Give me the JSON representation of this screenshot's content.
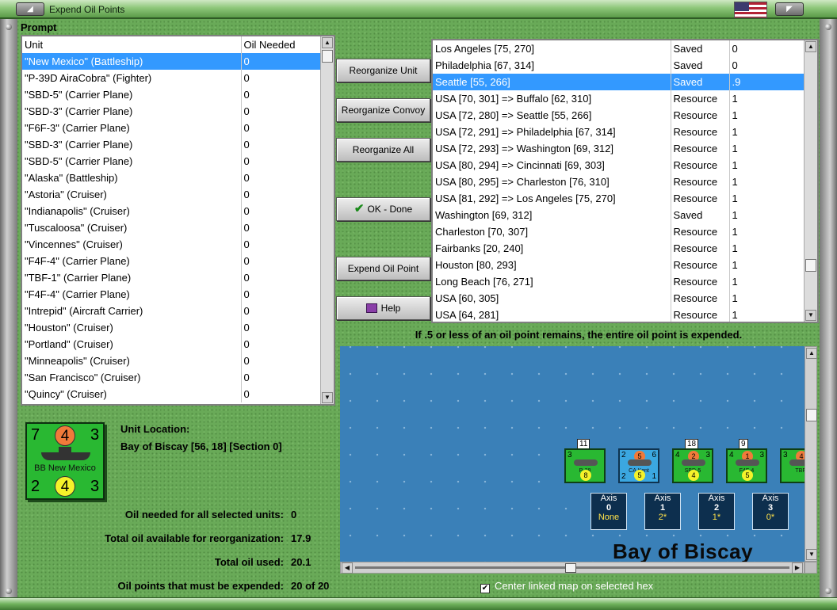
{
  "window": {
    "title": "Expend Oil Points"
  },
  "prompt_label": "Prompt",
  "unit_list": {
    "headers": [
      "Unit",
      "Oil Needed"
    ],
    "rows": [
      {
        "unit": "\"New Mexico\" (Battleship)",
        "oil": "0",
        "selected": true
      },
      {
        "unit": "\"P-39D AiraCobra\" (Fighter)",
        "oil": "0"
      },
      {
        "unit": "\"SBD-5\" (Carrier Plane)",
        "oil": "0"
      },
      {
        "unit": "\"SBD-3\" (Carrier Plane)",
        "oil": "0"
      },
      {
        "unit": "\"F6F-3\" (Carrier Plane)",
        "oil": "0"
      },
      {
        "unit": "\"SBD-3\" (Carrier Plane)",
        "oil": "0"
      },
      {
        "unit": "\"SBD-5\" (Carrier Plane)",
        "oil": "0"
      },
      {
        "unit": "\"Alaska\" (Battleship)",
        "oil": "0"
      },
      {
        "unit": "\"Astoria\" (Cruiser)",
        "oil": "0"
      },
      {
        "unit": "\"Indianapolis\" (Cruiser)",
        "oil": "0"
      },
      {
        "unit": "\"Tuscaloosa\" (Cruiser)",
        "oil": "0"
      },
      {
        "unit": "\"Vincennes\" (Cruiser)",
        "oil": "0"
      },
      {
        "unit": "\"F4F-4\" (Carrier Plane)",
        "oil": "0"
      },
      {
        "unit": "\"TBF-1\" (Carrier Plane)",
        "oil": "0"
      },
      {
        "unit": "\"F4F-4\" (Carrier Plane)",
        "oil": "0"
      },
      {
        "unit": "\"Intrepid\" (Aircraft Carrier)",
        "oil": "0"
      },
      {
        "unit": "\"Houston\" (Cruiser)",
        "oil": "0"
      },
      {
        "unit": "\"Portland\" (Cruiser)",
        "oil": "0"
      },
      {
        "unit": "\"Minneapolis\" (Cruiser)",
        "oil": "0"
      },
      {
        "unit": "\"San Francisco\" (Cruiser)",
        "oil": "0"
      },
      {
        "unit": "\"Quincy\" (Cruiser)",
        "oil": "0"
      }
    ]
  },
  "buttons": {
    "reorganize_unit": "Reorganize Unit",
    "reorganize_convoy": "Reorganize Convoy",
    "reorganize_all": "Reorganize All",
    "ok_done": "OK - Done",
    "expend_oil_point": "Expend Oil Point",
    "help": "Help"
  },
  "oil_list": {
    "rows": [
      {
        "location": "Los Angeles [75, 270]",
        "type": "Saved",
        "amount": "0"
      },
      {
        "location": "Philadelphia [67, 314]",
        "type": "Saved",
        "amount": "0"
      },
      {
        "location": "Seattle [55, 266]",
        "type": "Saved",
        "amount": ".9",
        "selected": true
      },
      {
        "location": "USA [70, 301] => Buffalo [62, 310]",
        "type": "Resource",
        "amount": "1"
      },
      {
        "location": "USA [72, 280] => Seattle [55, 266]",
        "type": "Resource",
        "amount": "1"
      },
      {
        "location": "USA [72, 291] => Philadelphia [67, 314]",
        "type": "Resource",
        "amount": "1"
      },
      {
        "location": "USA [72, 293] => Washington [69, 312]",
        "type": "Resource",
        "amount": "1"
      },
      {
        "location": "USA [80, 294] => Cincinnati [69, 303]",
        "type": "Resource",
        "amount": "1"
      },
      {
        "location": "USA [80, 295] => Charleston [76, 310]",
        "type": "Resource",
        "amount": "1"
      },
      {
        "location": "USA [81, 292] => Los Angeles [75, 270]",
        "type": "Resource",
        "amount": "1"
      },
      {
        "location": "Washington [69, 312]",
        "type": "Saved",
        "amount": "1"
      },
      {
        "location": "Charleston [70, 307]",
        "type": "Resource",
        "amount": "1"
      },
      {
        "location": "Fairbanks [20, 240]",
        "type": "Resource",
        "amount": "1"
      },
      {
        "location": "Houston [80, 293]",
        "type": "Resource",
        "amount": "1"
      },
      {
        "location": "Long Beach [76, 271]",
        "type": "Resource",
        "amount": "1"
      },
      {
        "location": "USA [60, 305]",
        "type": "Resource",
        "amount": "1"
      },
      {
        "location": "USA [64, 281]",
        "type": "Resource",
        "amount": "1"
      }
    ]
  },
  "note": "If .5 or less of an oil point remains, the entire oil point is expended.",
  "map": {
    "name": "Bay of Biscay",
    "stacks": [
      {
        "count": "11",
        "top_left": "3",
        "top_right": "",
        "circle": "",
        "bottom_left": "",
        "bottom_circle": "8",
        "bottom_right": "",
        "label": "P-38",
        "color": "green"
      },
      {
        "count": "",
        "top_left": "2",
        "top_right": "6",
        "circle": "5",
        "bottom_left": "2",
        "bottom_circle": "5",
        "bottom_right": "1",
        "label": "CA Kent",
        "color": "blue"
      },
      {
        "count": "18",
        "top_left": "4",
        "top_right": "3",
        "circle": "2",
        "bottom_left": "",
        "bottom_circle": "4",
        "bottom_right": "",
        "label": "SBD-5",
        "color": "green"
      },
      {
        "count": "9",
        "top_left": "4",
        "top_right": "3",
        "circle": "1",
        "bottom_left": "",
        "bottom_circle": "5",
        "bottom_right": "",
        "label": "F4F-4",
        "color": "green"
      },
      {
        "count": "",
        "top_left": "3",
        "top_right": "",
        "circle": "4",
        "bottom_left": "",
        "bottom_circle": "",
        "bottom_right": "",
        "label": "TBF",
        "color": "green"
      }
    ],
    "axis_boxes": [
      {
        "title": "Axis",
        "num": "0",
        "sub": "None"
      },
      {
        "title": "Axis",
        "num": "1",
        "sub": "2*"
      },
      {
        "title": "Axis",
        "num": "2",
        "sub": "1*"
      },
      {
        "title": "Axis",
        "num": "3",
        "sub": "0*"
      }
    ]
  },
  "unit_counter": {
    "top_left": "7",
    "top_mid": "4",
    "top_right": "3",
    "bottom_left": "2",
    "bottom_mid": "4",
    "bottom_right": "3",
    "name": "BB New Mexico"
  },
  "location": {
    "label": "Unit Location:",
    "value": "Bay of Biscay [56, 18] [Section 0]"
  },
  "stats": [
    {
      "label": "Oil needed for all selected units:",
      "value": "0"
    },
    {
      "label": "Total oil available for reorganization:",
      "value": "17.9"
    },
    {
      "label": "Total oil used:",
      "value": "20.1"
    },
    {
      "label": "Oil points that must be expended:",
      "value": "20 of 20"
    }
  ],
  "center_map": {
    "label": "Center linked map on selected hex",
    "checked": true
  },
  "colors": {
    "selection": "#3399ff",
    "counter_green": "#29b832",
    "sea": "#3a80b8"
  }
}
